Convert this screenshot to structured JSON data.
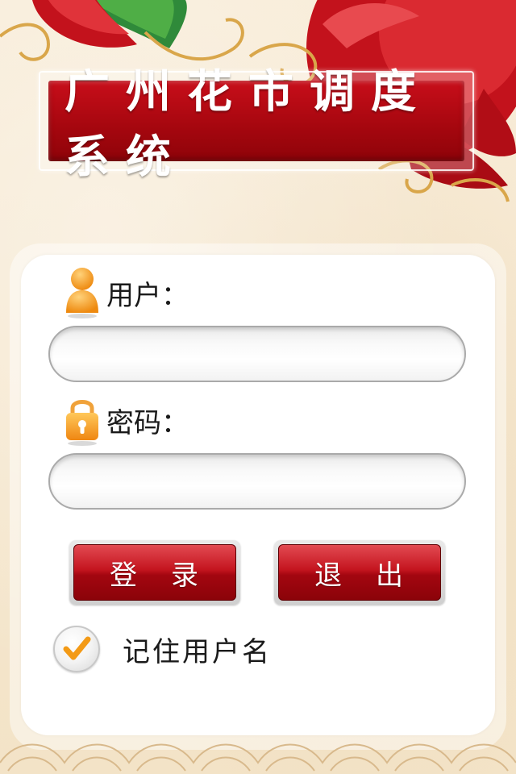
{
  "app": {
    "title": "广州花市调度系统"
  },
  "login": {
    "username_label": "用户：",
    "username_value": "",
    "password_label": "密码：",
    "password_value": "",
    "login_button": "登录",
    "exit_button": "退出",
    "remember_label": "记住用户名",
    "remember_checked": true
  },
  "icons": {
    "user": "user-icon",
    "lock": "lock-icon",
    "check": "checkmark-icon"
  },
  "colors": {
    "title_red": "#a7070f",
    "button_red": "#b00a14",
    "icon_orange": "#f39a16"
  }
}
